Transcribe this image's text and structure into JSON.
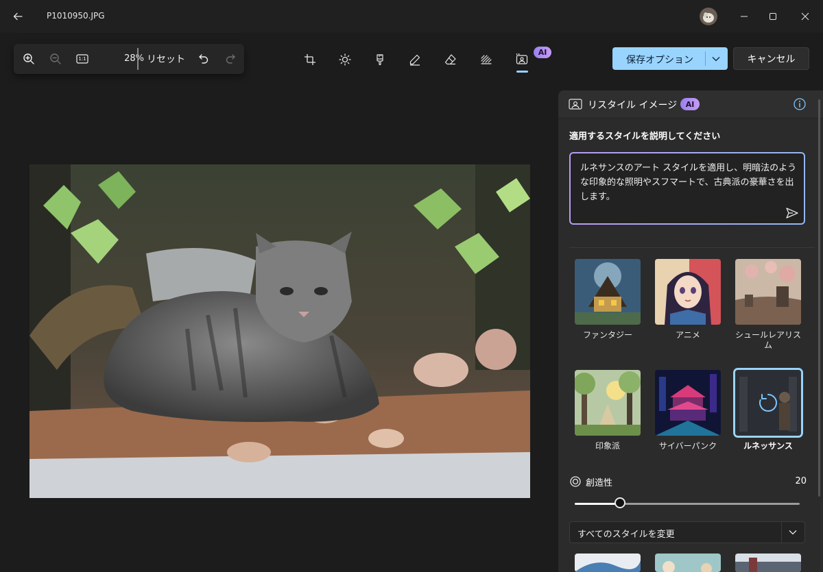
{
  "window": {
    "file_name": "P1010950.JPG"
  },
  "zoom_toolbar": {
    "zoom_percent": "28%",
    "reset_label": "リセット",
    "actual_size_label": "1:1"
  },
  "tools": {
    "ai_badge": "AI",
    "active_tool": "restyle-image"
  },
  "actions": {
    "save_label": "保存オプション",
    "cancel_label": "キャンセル"
  },
  "panel": {
    "title": "リスタイル イメージ",
    "ai_badge": "AI",
    "prompt_label": "適用するスタイルを説明してください",
    "prompt_text": "ルネサンスのアート スタイルを適用し、明暗法のような印象的な照明やスフマートで、古典派の豪華さを出します。",
    "styles": [
      {
        "label": "ファンタジー",
        "selected": false
      },
      {
        "label": "アニメ",
        "selected": false
      },
      {
        "label": "シュールレアリスム",
        "selected": false
      },
      {
        "label": "印象派",
        "selected": false
      },
      {
        "label": "サイバーパンク",
        "selected": false
      },
      {
        "label": "ルネッサンス",
        "selected": true
      }
    ],
    "creativity": {
      "label": "創造性",
      "value": "20",
      "fraction": 0.2
    },
    "change_all_label": "すべてのスタイルを変更"
  },
  "colors": {
    "accent": "#99d4ff",
    "background": "#1c1c1c",
    "panel": "#2b2b2b"
  }
}
